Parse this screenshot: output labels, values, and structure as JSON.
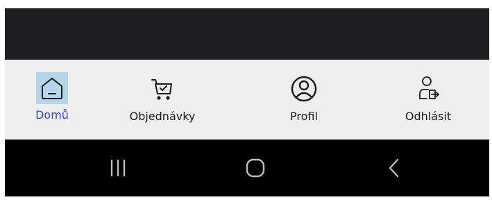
{
  "colors": {
    "status_bar": "#1f1f21",
    "nav_background": "#eeeeee",
    "active_highlight": "#b5d6ea",
    "active_text": "#3b47d4",
    "system_nav": "#000000"
  },
  "bottom_nav": {
    "items": [
      {
        "label": "Domů",
        "icon": "home-icon",
        "active": true
      },
      {
        "label": "Objednávky",
        "icon": "cart-icon",
        "active": false
      },
      {
        "label": "Profil",
        "icon": "profile-icon",
        "active": false
      },
      {
        "label": "Odhlásit",
        "icon": "logout-icon",
        "active": false
      }
    ]
  },
  "system_nav": {
    "buttons": [
      {
        "icon": "recent-apps-icon"
      },
      {
        "icon": "home-circle-icon"
      },
      {
        "icon": "back-icon"
      }
    ]
  }
}
